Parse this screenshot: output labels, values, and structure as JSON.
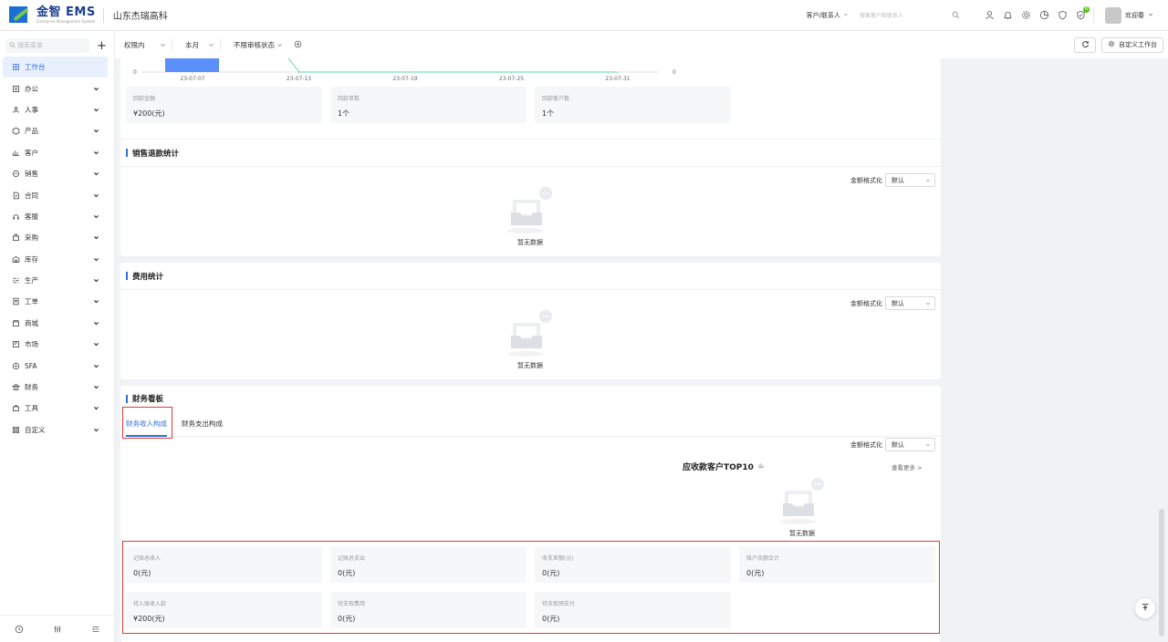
{
  "header": {
    "logo_name": "金智 EMS",
    "logo_sub": "Enterprise Management System",
    "company": "山东杰瑞高科",
    "scope": "客户/联系人",
    "search_placeholder": "搜索客户和联系人",
    "badge": "8",
    "username": "欢迎春"
  },
  "sidebar": {
    "search_placeholder": "搜索菜单",
    "items": [
      {
        "label": "工作台",
        "icon": "grid-icon",
        "active": true
      },
      {
        "label": "办公",
        "icon": "office-icon"
      },
      {
        "label": "人事",
        "icon": "people-icon"
      },
      {
        "label": "产品",
        "icon": "box-icon"
      },
      {
        "label": "客户",
        "icon": "customer-icon"
      },
      {
        "label": "销售",
        "icon": "sales-icon"
      },
      {
        "label": "合同",
        "icon": "contract-icon"
      },
      {
        "label": "客服",
        "icon": "service-icon"
      },
      {
        "label": "采购",
        "icon": "purchase-icon"
      },
      {
        "label": "库存",
        "icon": "warehouse-icon"
      },
      {
        "label": "生产",
        "icon": "production-icon"
      },
      {
        "label": "工单",
        "icon": "ticket-icon"
      },
      {
        "label": "商城",
        "icon": "shop-icon"
      },
      {
        "label": "市场",
        "icon": "market-icon"
      },
      {
        "label": "SFA",
        "icon": "sfa-icon"
      },
      {
        "label": "财务",
        "icon": "finance-icon"
      },
      {
        "label": "工具",
        "icon": "tool-icon"
      },
      {
        "label": "自定义",
        "icon": "custom-icon"
      }
    ]
  },
  "filters": {
    "scope": "权限内",
    "period": "本月",
    "status": "不限审核状态",
    "customize_label": "自定义工作台"
  },
  "colors": {
    "accent": "#2f6fe0",
    "bar": "#5b8ff9",
    "line": "#5ad8a6",
    "highlight": "#e53935"
  },
  "chart_data": {
    "type": "bar",
    "categories": [
      "23-07-07",
      "23-07-13",
      "23-07-19",
      "23-07-25",
      "23-07-31"
    ],
    "y_axis_left_min": "0",
    "y_axis_right_min": "0"
  },
  "collection_stats": [
    {
      "label": "回款金额",
      "value": "¥200(元)"
    },
    {
      "label": "回款单数",
      "value": "1个"
    },
    {
      "label": "回款客户数",
      "value": "1个"
    }
  ],
  "refund_card": {
    "title": "销售退款统计",
    "fmt_label": "金额格式化",
    "fmt_value": "默认",
    "empty": "暂无数据"
  },
  "expense_card": {
    "title": "费用统计",
    "fmt_label": "金额格式化",
    "fmt_value": "默认",
    "empty": "暂无数据"
  },
  "finance_card": {
    "title": "财务看板",
    "tabs": [
      "财务收入构成",
      "财务支出构成"
    ],
    "fmt_label": "金额格式化",
    "fmt_value": "默认",
    "top10_title": "应收款客户TOP10",
    "more": "查看更多 >",
    "empty": "暂无数据",
    "stats": [
      {
        "label": "记账总收入",
        "value": "0(元)"
      },
      {
        "label": "记账总支出",
        "value": "0(元)"
      },
      {
        "label": "收支差额(元)",
        "value": "0(元)"
      },
      {
        "label": "账户余额合计",
        "value": "0(元)"
      },
      {
        "label": "待入账收入款",
        "value": "¥200(元)"
      },
      {
        "label": "待支取费用",
        "value": "0(元)"
      },
      {
        "label": "待支取预支付",
        "value": "0(元)"
      }
    ]
  }
}
